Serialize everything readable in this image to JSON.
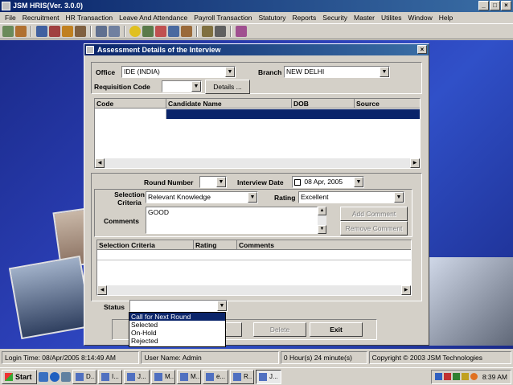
{
  "app": {
    "title": "JSM HRIS(Ver. 3.0.0)",
    "win_buttons": [
      "_",
      "□",
      "×"
    ]
  },
  "menu": [
    "File",
    "Recruitment",
    "HR Transaction",
    "Leave And Attendance",
    "Payroll Transaction",
    "Statutory",
    "Reports",
    "Security",
    "Master",
    "Utilites",
    "Window",
    "Help"
  ],
  "dialog": {
    "title": "Assessment Details of the Interview",
    "close": "×",
    "office_label": "Office",
    "office_value": "IDE (INDIA)",
    "branch_label": "Branch",
    "branch_value": "NEW DELHI",
    "requisition_label": "Requisition Code",
    "requisition_value": "",
    "details_button": "Details ...",
    "candidate_grid": {
      "headers": [
        "Code",
        "Candidate Name",
        "DOB",
        "Source"
      ]
    },
    "round_label": "Round Number",
    "round_value": "",
    "interview_date_label": "Interview Date",
    "interview_date_value": "08 Apr, 2005",
    "selection_criteria_label": "Selection Criteria",
    "selection_criteria_value": "Relevant Knowledge",
    "rating_label": "Rating",
    "rating_value": "Excellent",
    "comments_label": "Comments",
    "comments_value": "GOOD",
    "add_comment_button": "Add Comment",
    "remove_comment_button": "Remove Comment",
    "criteria_grid": {
      "headers": [
        "Selection Criteria",
        "Rating",
        "Comments"
      ]
    },
    "status_label": "Status",
    "status_value": "",
    "status_options": [
      "Call for Next Round",
      "Selected",
      "On-Hold",
      "Rejected"
    ],
    "apply_button": "ly",
    "delete_button": "Delete",
    "exit_button": "Exit"
  },
  "statusbar": {
    "login": "Login Time: 08/Apr/2005 8:14:49 AM",
    "user": "User Name: Admin",
    "elapsed": "0 Hour(s) 24 minute(s)",
    "copyright": "Copyright  © 2003  JSM Technologies"
  },
  "taskbar": {
    "start": "Start",
    "tasks": [
      "D..",
      "I...",
      "J...",
      "M..",
      "M..",
      "e...",
      "R..",
      "J..."
    ],
    "clock": "8:39 AM"
  }
}
